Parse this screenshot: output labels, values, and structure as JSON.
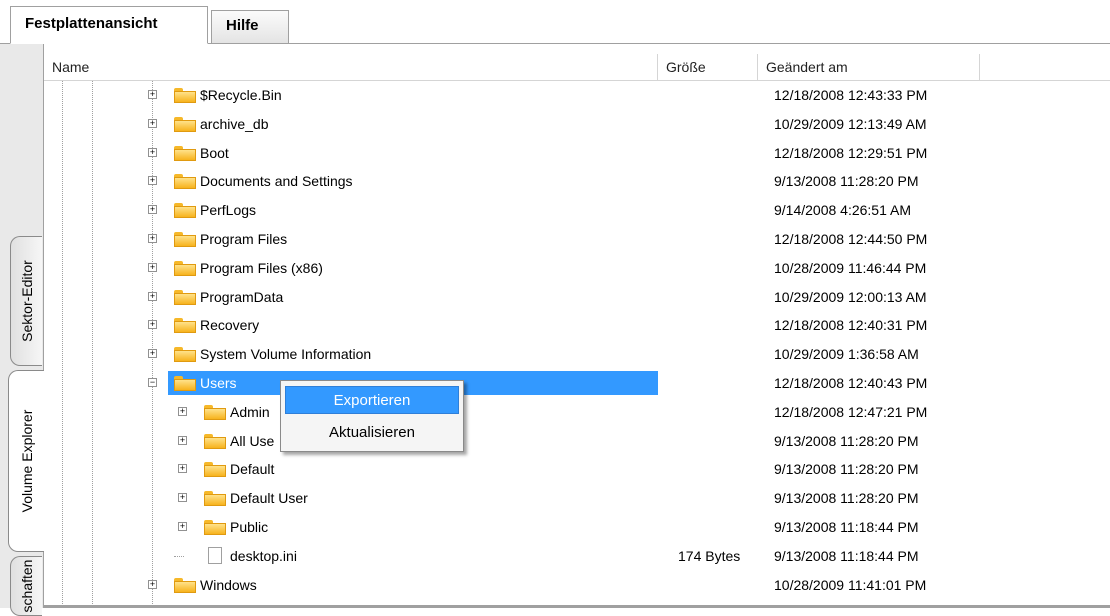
{
  "tabs": [
    {
      "label": "Festplattenansicht",
      "active": true
    },
    {
      "label": "Hilfe",
      "active": false
    }
  ],
  "side_tabs": [
    "Sektor-Editor",
    "Volume Explorer",
    "schaften"
  ],
  "columns": {
    "name": "Name",
    "size": "Größe",
    "modified": "Geändert am"
  },
  "rows": [
    {
      "name": "$Recycle.Bin",
      "size": "",
      "modified": "12/18/2008 12:43:33 PM",
      "type": "folder",
      "level": 1
    },
    {
      "name": "archive_db",
      "size": "",
      "modified": "10/29/2009 12:13:49 AM",
      "type": "folder",
      "level": 1
    },
    {
      "name": "Boot",
      "size": "",
      "modified": "12/18/2008 12:29:51 PM",
      "type": "folder",
      "level": 1
    },
    {
      "name": "Documents and Settings",
      "size": "",
      "modified": "9/13/2008 11:28:20 PM",
      "type": "folder",
      "level": 1
    },
    {
      "name": "PerfLogs",
      "size": "",
      "modified": "9/14/2008 4:26:51 AM",
      "type": "folder",
      "level": 1
    },
    {
      "name": "Program Files",
      "size": "",
      "modified": "12/18/2008 12:44:50 PM",
      "type": "folder",
      "level": 1
    },
    {
      "name": "Program Files (x86)",
      "size": "",
      "modified": "10/28/2009 11:46:44 PM",
      "type": "folder",
      "level": 1
    },
    {
      "name": "ProgramData",
      "size": "",
      "modified": "10/29/2009 12:00:13 AM",
      "type": "folder",
      "level": 1
    },
    {
      "name": "Recovery",
      "size": "",
      "modified": "12/18/2008 12:40:31 PM",
      "type": "folder",
      "level": 1
    },
    {
      "name": "System Volume Information",
      "size": "",
      "modified": "10/29/2009 1:36:58 AM",
      "type": "folder",
      "level": 1
    },
    {
      "name": "Users",
      "size": "",
      "modified": "12/18/2008 12:40:43 PM",
      "type": "folder",
      "level": 1,
      "expanded": true,
      "selected": true
    },
    {
      "name": "Admin",
      "size": "",
      "modified": "12/18/2008 12:47:21 PM",
      "type": "folder",
      "level": 2
    },
    {
      "name": "All Use",
      "size": "",
      "modified": "9/13/2008 11:28:20 PM",
      "type": "folder",
      "level": 2
    },
    {
      "name": "Default",
      "size": "",
      "modified": "9/13/2008 11:28:20 PM",
      "type": "folder",
      "level": 2
    },
    {
      "name": "Default User",
      "size": "",
      "modified": "9/13/2008 11:28:20 PM",
      "type": "folder",
      "level": 2
    },
    {
      "name": "Public",
      "size": "",
      "modified": "9/13/2008 11:18:44 PM",
      "type": "folder",
      "level": 2
    },
    {
      "name": "desktop.ini",
      "size": "174 Bytes",
      "modified": "9/13/2008 11:18:44 PM",
      "type": "file",
      "level": 2
    },
    {
      "name": "Windows",
      "size": "",
      "modified": "10/28/2009 11:41:01 PM",
      "type": "folder",
      "level": 1
    }
  ],
  "context_menu": {
    "items": [
      "Exportieren",
      "Aktualisieren"
    ],
    "highlighted_index": 0
  },
  "colors": {
    "selection": "#3399ff",
    "folder": "#f7b31d"
  }
}
